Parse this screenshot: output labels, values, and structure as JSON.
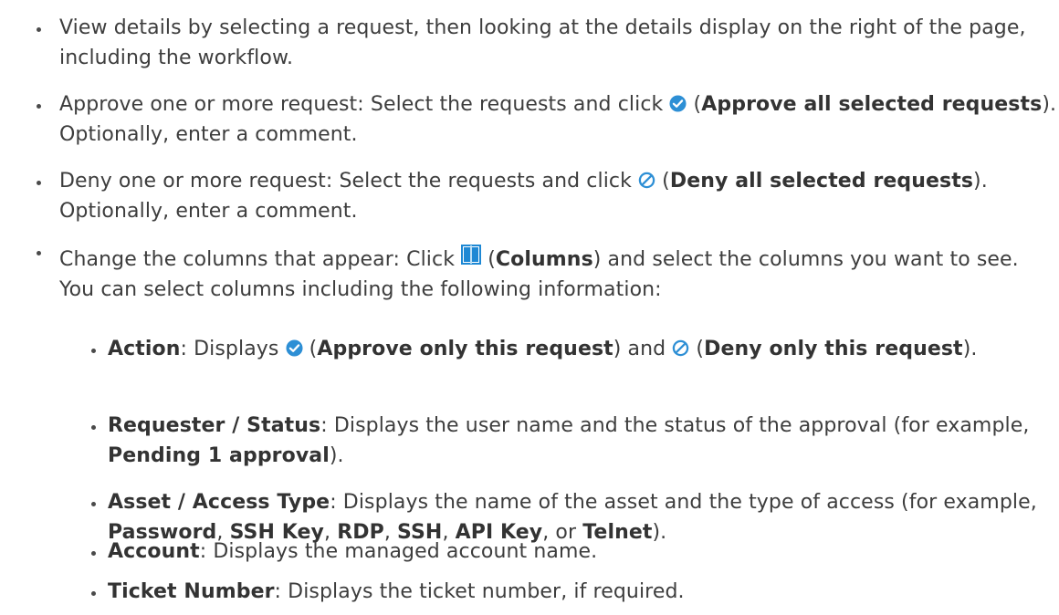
{
  "list": {
    "item1": {
      "text": "View details by selecting a request, then looking at the details display on the right of the page, including the workflow."
    },
    "item2": {
      "prefix": "Approve one or more request: Select the requests and click ",
      "label_open": " (",
      "label_bold": "Approve all selected requests",
      "suffix": "). Optionally, enter a comment.",
      "icon": "approve-check-icon"
    },
    "item3": {
      "prefix": "Deny one or more request: Select the requests and click ",
      "label_open": " (",
      "label_bold": "Deny all selected requests",
      "suffix": "). Optionally, enter a comment.",
      "icon": "deny-circle-slash-icon"
    },
    "item4": {
      "prefix": "Change the columns that appear: Click ",
      "label_open": " (",
      "label_bold": "Columns",
      "suffix": ") and select the columns you want to see. You can select columns including the following information:",
      "icon": "columns-icon"
    },
    "sub": {
      "action": {
        "term": "Action",
        "after_term": ": Displays ",
        "approve_open": " (",
        "approve_bold": "Approve only this request",
        "mid": ") and ",
        "deny_open": " (",
        "deny_bold": "Deny only this request",
        "end": ")."
      },
      "requester": {
        "term": "Requester / Status",
        "desc": ": Displays the user name and the status of the approval (for example, ",
        "example": "Pending 1 approval",
        "end": ")."
      },
      "asset": {
        "term": "Asset / Access Type",
        "desc": ": Displays the name of the asset and the type of access (for example, ",
        "ex1": "Password",
        "sep1": ", ",
        "ex2": "SSH Key",
        "sep2": ", ",
        "ex3": "RDP",
        "sep3": ", ",
        "ex4": "SSH",
        "sep4": ", ",
        "ex5": "API Key",
        "sep5": ", or ",
        "ex6": "Telnet",
        "end": ")."
      },
      "account": {
        "term": "Account",
        "desc": ": Displays the managed account name."
      },
      "ticket": {
        "term": "Ticket Number",
        "desc": ": Displays the ticket number, if required."
      }
    }
  },
  "colors": {
    "approve_icon": "#2d8fd5",
    "deny_icon": "#2d8fd5",
    "columns_icon": "#1e88d4",
    "text": "#3d3d3d"
  }
}
